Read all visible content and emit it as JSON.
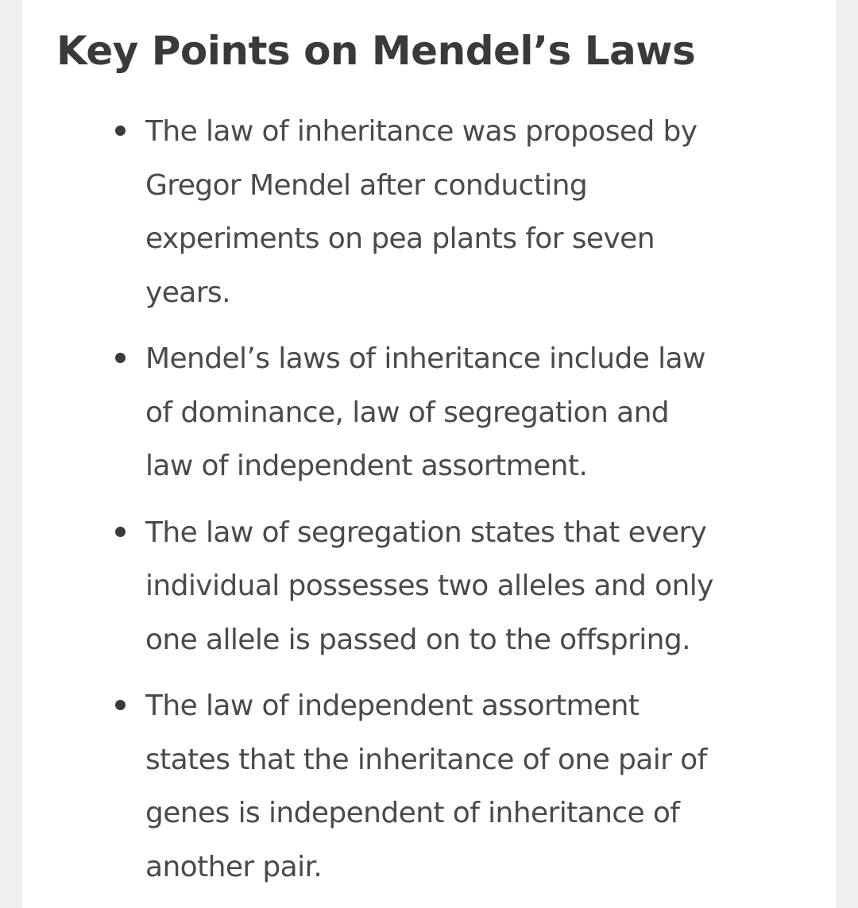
{
  "title": "Key Points on Mendel’s Laws",
  "points": [
    {
      "lines": [
        "The law of inheritance was proposed by",
        "Gregor Mendel after conducting",
        "experiments on pea plants for seven",
        "years."
      ]
    },
    {
      "lines": [
        "Mendel’s laws of inheritance include law",
        "of dominance, law of segregation and",
        "law of independent assortment."
      ]
    },
    {
      "lines": [
        "The law of segregation states that every",
        "individual possesses two alleles and only",
        "one allele is passed on to the offspring."
      ]
    },
    {
      "lines": [
        "The law of independent assortment",
        "states that the inheritance of one pair of",
        "genes is independent of inheritance of",
        "another pair."
      ]
    }
  ]
}
